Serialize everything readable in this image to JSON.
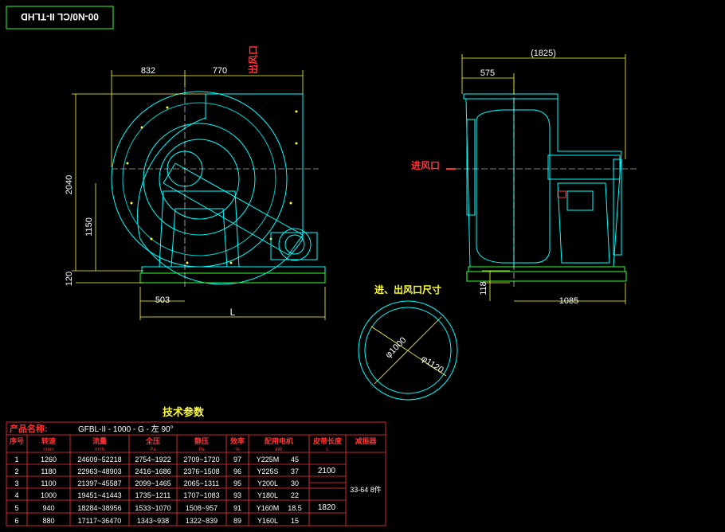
{
  "drawing_code": "00-N0/CL II-TLHD",
  "dims": {
    "d832": "832",
    "d770": "770",
    "outlet": "出风口",
    "d2040": "2040",
    "d1150": "1150",
    "d120": "120",
    "d503": "503",
    "dL": "L",
    "d1825": "(1825)",
    "d575": "575",
    "inlet": "进风口",
    "d118": "118",
    "d1085": "1085",
    "port_title": "进、出风口尺寸",
    "d1000": "φ1000",
    "d1120": "φ1120"
  },
  "table": {
    "title": "技术参数",
    "product_label": "产品名称:",
    "product_value": "GFBL-II - 1000 - G - 左 90°",
    "headers": [
      "序号",
      "转速",
      "流量",
      "全压",
      "静压",
      "效率",
      "配用电机",
      "皮带长度",
      "减振器"
    ],
    "subheaders": [
      "",
      "r/min",
      "m³/h",
      "Pa",
      "Pa",
      "%",
      "kW",
      "L",
      ""
    ],
    "rows": [
      [
        "1",
        "1260",
        "24609~52218",
        "2754~1922",
        "2709~1720",
        "97",
        "Y225M",
        "45"
      ],
      [
        "2",
        "1180",
        "22963~48903",
        "2416~1686",
        "2376~1508",
        "96",
        "Y225S",
        "37"
      ],
      [
        "3",
        "1100",
        "21397~45587",
        "2099~1465",
        "2065~1311",
        "95",
        "Y200L",
        "30"
      ],
      [
        "4",
        "1000",
        "19451~41443",
        "1735~1211",
        "1707~1083",
        "93",
        "Y180L",
        "22"
      ],
      [
        "5",
        "940",
        "18284~38956",
        "1533~1070",
        "1508~957",
        "91",
        "Y160M",
        "18.5"
      ],
      [
        "6",
        "880",
        "17117~36470",
        "1343~938",
        "1322~839",
        "89",
        "Y160L",
        "15"
      ]
    ],
    "belt_a": "2100",
    "belt_b": "1820",
    "damper": "33-64 8件"
  },
  "colors": {
    "outline": "#00ffff",
    "dim": "#ffff33",
    "red": "#ff3333",
    "text": "#ffffff",
    "green": "#33ff33"
  }
}
